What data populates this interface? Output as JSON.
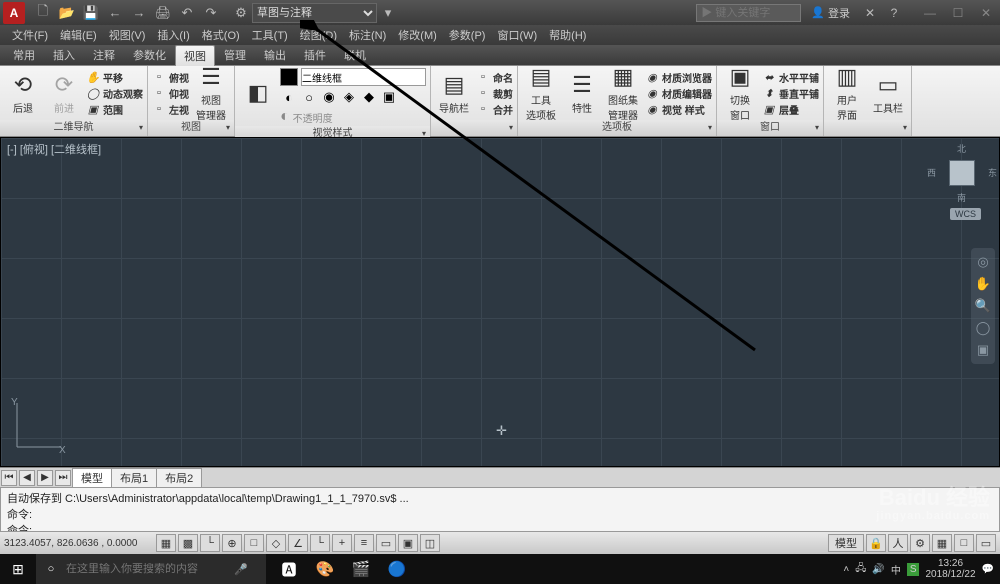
{
  "titlebar": {
    "logo": "A",
    "workspace": "草图与注释",
    "search_ph": "▶ 键入关键字",
    "login": "登录"
  },
  "qat": [
    "🗋",
    "📂",
    "💾",
    "←",
    "→",
    "🖨",
    "↶",
    "↷"
  ],
  "win": [
    "—",
    "☐",
    "✕"
  ],
  "menus": [
    "文件(F)",
    "编辑(E)",
    "视图(V)",
    "插入(I)",
    "格式(O)",
    "工具(T)",
    "绘图(D)",
    "标注(N)",
    "修改(M)",
    "参数(P)",
    "窗口(W)",
    "帮助(H)"
  ],
  "tabs": [
    "常用",
    "插入",
    "注释",
    "参数化",
    "视图",
    "管理",
    "输出",
    "插件",
    "联机"
  ],
  "ribbon": {
    "nav": {
      "title": "二维导航",
      "back": "后退",
      "fwd": "前进",
      "items": [
        "平移",
        "动态观察",
        "范围"
      ]
    },
    "views": {
      "title": "视图",
      "items": [
        "俯视",
        "仰视",
        "左视"
      ],
      "mgr": "视图\n管理器"
    },
    "visual": {
      "title": "视觉样式",
      "combo": "二维线框",
      "disabled": "不透明度"
    },
    "vport": {
      "title": "",
      "nav": "导航栏"
    },
    "sheet": {
      "items": [
        "命名",
        "裁剪",
        "合并"
      ]
    },
    "palettes": {
      "title": "选项板",
      "items": [
        "工具\n选项板",
        "特性",
        "图纸集\n管理器"
      ],
      "side": [
        "材质浏览器",
        "材质编辑器",
        "视觉 样式"
      ]
    },
    "window": {
      "title": "窗口",
      "items": [
        "水平平铺",
        "垂直平铺",
        "层叠"
      ],
      "sw": "切换\n窗口"
    },
    "ui": {
      "title": "",
      "items": [
        "用户\n界面",
        "工具栏"
      ]
    }
  },
  "viewport": {
    "label": "[-] [俯视] [二维线框]",
    "wcs": "WCS",
    "n": "北",
    "s": "南",
    "e": "东",
    "w": "西"
  },
  "layout": {
    "tabs": [
      "模型",
      "布局1",
      "布局2"
    ]
  },
  "cmd": {
    "l1": "自动保存到 C:\\Users\\Administrator\\appdata\\local\\temp\\Drawing1_1_1_7970.sv$ ...",
    "l2": "命令:",
    "l3": "命令:"
  },
  "status": {
    "coords": "3123.4057, 826.0636 , 0.0000",
    "right": "模型"
  },
  "taskbar": {
    "search_ph": "在这里输入你要搜索的内容",
    "time": "13:26",
    "date": "2018/12/22"
  },
  "watermark": {
    "main": "Baidu 经验",
    "sub": "jingyan.baidu.com"
  }
}
